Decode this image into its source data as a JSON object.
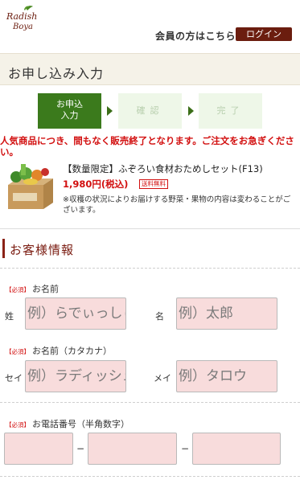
{
  "header": {
    "logo_text_line1": "Radish",
    "logo_text_line2": "Boya",
    "member_text": "会員の方はこちら",
    "login_label": "ログイン",
    "accent_color": "#6b1d0f"
  },
  "page_title": "お申し込み入力",
  "steps": [
    {
      "label_line1": "お申込",
      "label_line2": "入力",
      "active": true
    },
    {
      "label": "確認",
      "active": false
    },
    {
      "label": "完了",
      "active": false
    }
  ],
  "alert": {
    "line1": "人気商品につき、間もなく販売終了となります。ご注文をお急ぎくださ",
    "line2": "い。"
  },
  "product": {
    "name": "【数量限定】ふぞろい食材おためしセット(F13)",
    "price": "1,980円(税込)",
    "badge": "送料無料",
    "note": "※収穫の状況によりお届けする野菜・果物の内容は変わることがございます。"
  },
  "section": {
    "title": "お客様情報"
  },
  "form": {
    "required_label": "【必須】",
    "name": {
      "label": "お名前",
      "sei_prefix": "姓",
      "mei_prefix": "名",
      "sei_placeholder": "例）らでぃっしゅ",
      "mei_placeholder": "例）太郎"
    },
    "kana": {
      "label": "お名前（カタカナ）",
      "sei_prefix": "セイ",
      "mei_prefix": "メイ",
      "sei_placeholder": "例）ラディッシュ",
      "mei_placeholder": "例）タロウ"
    },
    "tel": {
      "label": "お電話番号（半角数字）",
      "separator": "−"
    }
  }
}
